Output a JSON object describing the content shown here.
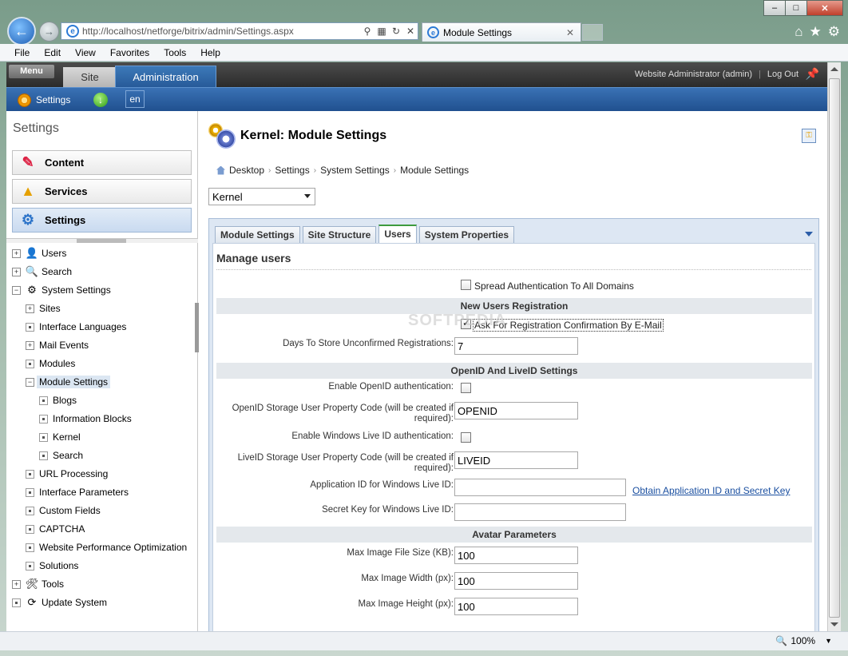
{
  "browser": {
    "address": "http://localhost/netforge/bitrix/admin/Settings.aspx",
    "address_host": "localhost",
    "tab_title": "Module Settings",
    "menu": [
      "File",
      "Edit",
      "View",
      "Favorites",
      "Tools",
      "Help"
    ],
    "zoom": "100%",
    "watermark": "SOFTPEDIA"
  },
  "panel": {
    "menu_label": "Menu",
    "site_tab": "Site",
    "admin_tab": "Administration",
    "user": "Website Administrator (admin)",
    "logout": "Log Out",
    "settings_label": "Settings",
    "lang": "en"
  },
  "sidebar": {
    "title": "Settings",
    "buttons": [
      "Content",
      "Services",
      "Settings"
    ],
    "tree": [
      {
        "label": "Users",
        "level": 0,
        "expander": "+"
      },
      {
        "label": "Search",
        "level": 0,
        "expander": "+"
      },
      {
        "label": "System Settings",
        "level": 0,
        "expander": "-"
      },
      {
        "label": "Sites",
        "level": 1,
        "expander": "+"
      },
      {
        "label": "Interface Languages",
        "level": 1,
        "expander": "dot"
      },
      {
        "label": "Mail Events",
        "level": 1,
        "expander": "+"
      },
      {
        "label": "Modules",
        "level": 1,
        "expander": "dot"
      },
      {
        "label": "Module Settings",
        "level": 1,
        "expander": "-"
      },
      {
        "label": "Blogs",
        "level": 2,
        "expander": "dot"
      },
      {
        "label": "Information Blocks",
        "level": 2,
        "expander": "dot"
      },
      {
        "label": "Kernel",
        "level": 2,
        "expander": "dot"
      },
      {
        "label": "Search",
        "level": 2,
        "expander": "dot"
      },
      {
        "label": "URL Processing",
        "level": 1,
        "expander": "dot"
      },
      {
        "label": "Interface Parameters",
        "level": 1,
        "expander": "dot"
      },
      {
        "label": "Custom Fields",
        "level": 1,
        "expander": "dot"
      },
      {
        "label": "CAPTCHA",
        "level": 1,
        "expander": "dot"
      },
      {
        "label": "Website Performance Optimization",
        "level": 1,
        "expander": "dot"
      },
      {
        "label": "Solutions",
        "level": 1,
        "expander": "dot"
      },
      {
        "label": "Tools",
        "level": 0,
        "expander": "+"
      },
      {
        "label": "Update System",
        "level": 0,
        "expander": "dot"
      }
    ]
  },
  "main": {
    "title": "Kernel: Module Settings",
    "breadcrumb": [
      "Desktop",
      "Settings",
      "System Settings",
      "Module Settings"
    ],
    "module_select": "Kernel",
    "tabs": [
      "Module Settings",
      "Site Structure",
      "Users",
      "System Properties"
    ],
    "content_title": "Manage users",
    "spread_auth": "Spread Authentication To All Domains",
    "sec_new_users": "New Users Registration",
    "ask_confirm": "Ask For Registration Confirmation By E-Mail",
    "days_label": "Days To Store Unconfirmed Registrations:",
    "days_value": "7",
    "sec_openid": "OpenID And LiveID Settings",
    "openid_enable": "Enable OpenID authentication:",
    "openid_code_label": "OpenID Storage User Property Code (will be created if required):",
    "openid_code_value": "OPENID",
    "liveid_enable": "Enable Windows Live ID authentication:",
    "liveid_code_label": "LiveID Storage User Property Code (will be created if required):",
    "liveid_code_value": "LIVEID",
    "app_id_label": "Application ID for Windows Live ID:",
    "app_id_link": "Obtain Application ID and Secret Key",
    "secret_label": "Secret Key for Windows Live ID:",
    "sec_avatar": "Avatar Parameters",
    "max_size_label": "Max Image File Size (KB):",
    "max_size_value": "100",
    "max_w_label": "Max Image Width (px):",
    "max_w_value": "100",
    "max_h_label": "Max Image Height (px):",
    "max_h_value": "100"
  }
}
